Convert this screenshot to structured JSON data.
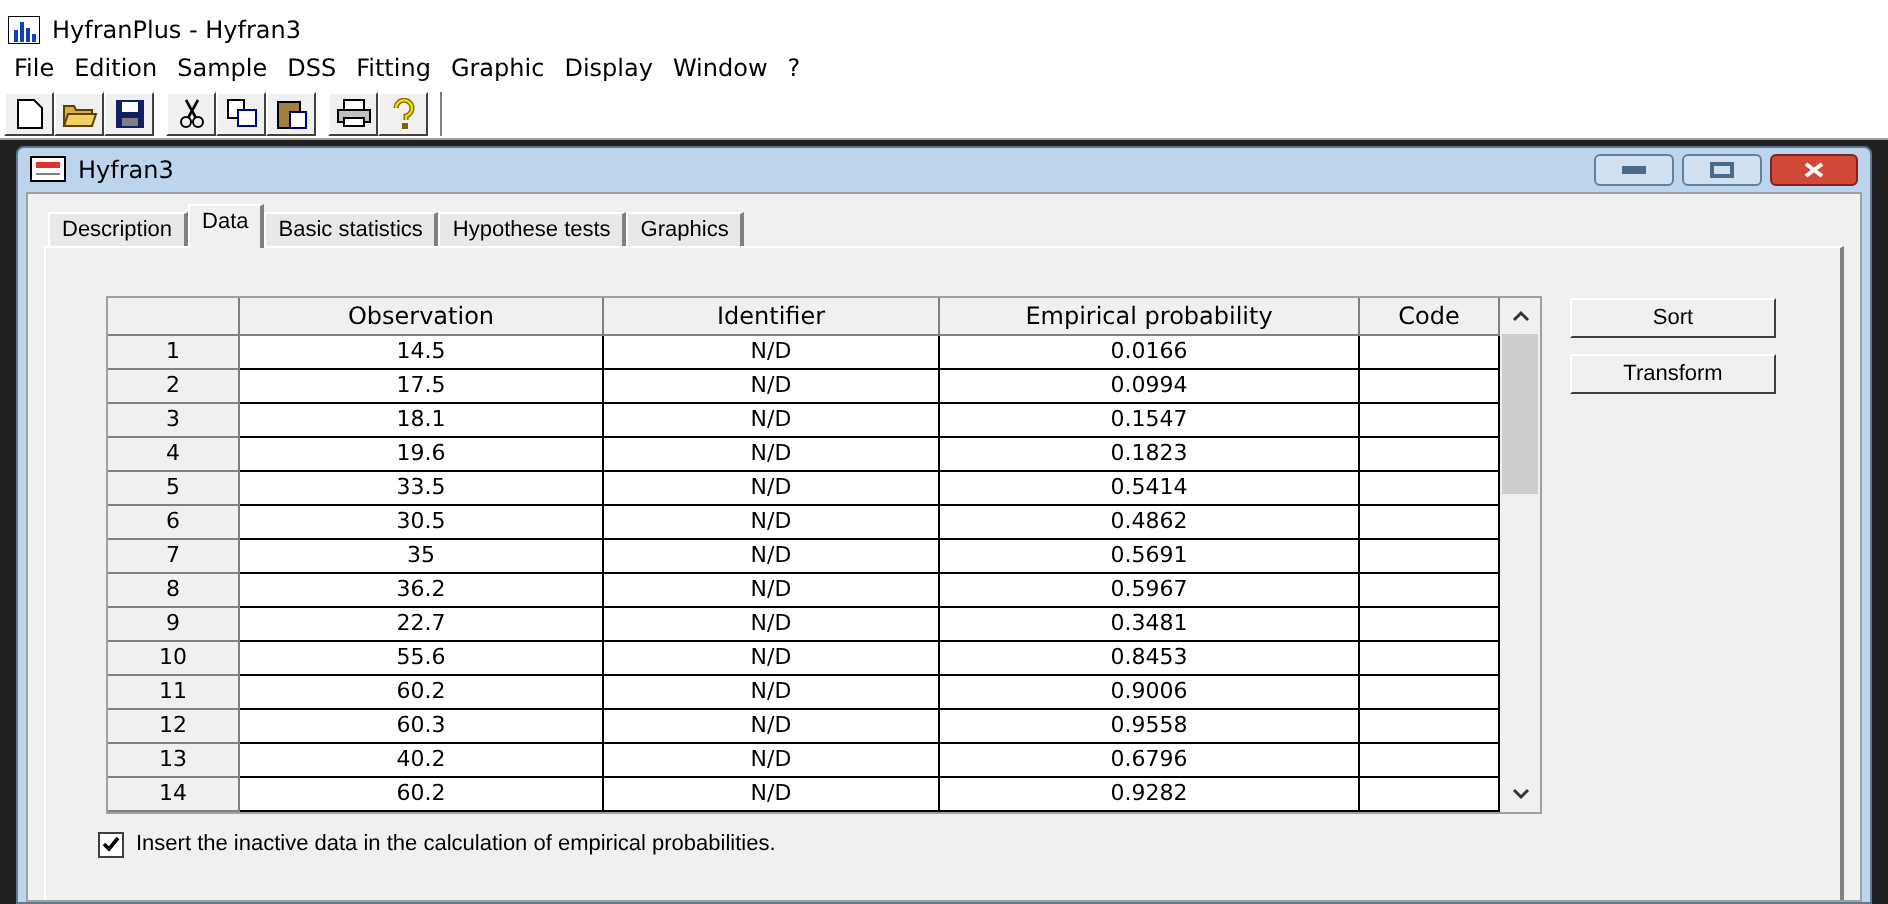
{
  "app": {
    "title": "HyfranPlus - Hyfran3"
  },
  "menu": [
    "File",
    "Edition",
    "Sample",
    "DSS",
    "Fitting",
    "Graphic",
    "Display",
    "Window",
    "?"
  ],
  "child_window": {
    "title": "Hyfran3"
  },
  "tabs": [
    {
      "label": "Description",
      "selected": false
    },
    {
      "label": "Data",
      "selected": true
    },
    {
      "label": "Basic statistics",
      "selected": false
    },
    {
      "label": "Hypothese tests",
      "selected": false
    },
    {
      "label": "Graphics",
      "selected": false
    }
  ],
  "table": {
    "columns": [
      "Observation",
      "Identifier",
      "Empirical probability",
      "Code"
    ],
    "rows": [
      {
        "number": "1",
        "observation": "14.5",
        "identifier": "N/D",
        "probability": "0.0166"
      },
      {
        "number": "2",
        "observation": "17.5",
        "identifier": "N/D",
        "probability": "0.0994"
      },
      {
        "number": "3",
        "observation": "18.1",
        "identifier": "N/D",
        "probability": "0.1547"
      },
      {
        "number": "4",
        "observation": "19.6",
        "identifier": "N/D",
        "probability": "0.1823"
      },
      {
        "number": "5",
        "observation": "33.5",
        "identifier": "N/D",
        "probability": "0.5414"
      },
      {
        "number": "6",
        "observation": "30.5",
        "identifier": "N/D",
        "probability": "0.4862"
      },
      {
        "number": "7",
        "observation": "35",
        "identifier": "N/D",
        "probability": "0.5691"
      },
      {
        "number": "8",
        "observation": "36.2",
        "identifier": "N/D",
        "probability": "0.5967"
      },
      {
        "number": "9",
        "observation": "22.7",
        "identifier": "N/D",
        "probability": "0.3481"
      },
      {
        "number": "10",
        "observation": "55.6",
        "identifier": "N/D",
        "probability": "0.8453"
      },
      {
        "number": "11",
        "observation": "60.2",
        "identifier": "N/D",
        "probability": "0.9006"
      },
      {
        "number": "12",
        "observation": "60.3",
        "identifier": "N/D",
        "probability": "0.9558"
      },
      {
        "number": "13",
        "observation": "40.2",
        "identifier": "N/D",
        "probability": "0.6796"
      },
      {
        "number": "14",
        "observation": "60.2",
        "identifier": "N/D",
        "probability": "0.9282"
      }
    ]
  },
  "buttons": [
    "Sort",
    "Transform"
  ],
  "option": {
    "label": "Insert the inactive data in the calculation of empirical probabilities.",
    "checked": true
  }
}
